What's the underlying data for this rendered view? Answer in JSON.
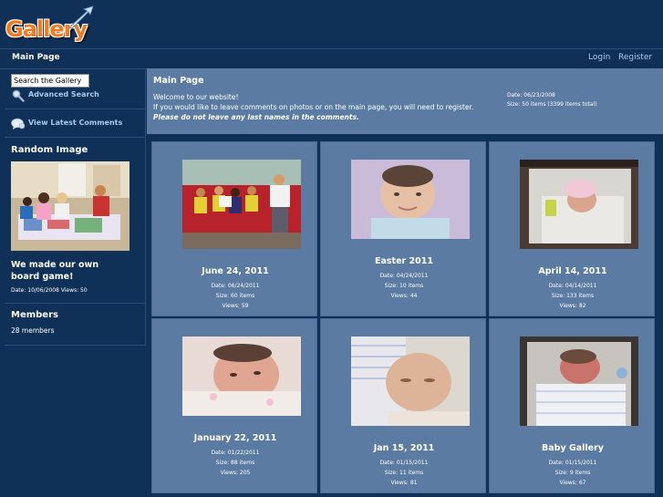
{
  "header": {
    "logo_text": "Gallery"
  },
  "nav": {
    "title": "Main Page",
    "login": "Login",
    "register": "Register"
  },
  "sidebar": {
    "search_value": "Search the Gallery",
    "advanced_search": "Advanced Search",
    "latest_comments": "View Latest Comments",
    "random_heading": "Random Image",
    "random_title": "We made our own board game!",
    "random_meta": "Date: 10/06/2008 Views: 50",
    "members_heading": "Members",
    "members_count": "28 members"
  },
  "main": {
    "title": "Main Page",
    "welcome": "Welcome to our website!",
    "comment_info": "If you would like to leave comments on photos or on the main page, you will need to register.",
    "warning": "Please do not leave any last names in the comments.",
    "date": "Date: 06/23/2008",
    "size": "Size: 50 items (3399 items total)"
  },
  "albums": [
    {
      "title": "June 24, 2011",
      "date": "Date: 06/24/2011",
      "size": "Size: 60 items",
      "views": "Views: 59"
    },
    {
      "title": "Easter 2011",
      "date": "Date: 04/24/2011",
      "size": "Size: 10 items",
      "views": "Views: 44"
    },
    {
      "title": "April 14, 2011",
      "date": "Date: 04/14/2011",
      "size": "Size: 133 items",
      "views": "Views: 82"
    },
    {
      "title": "January 22, 2011",
      "date": "Date: 01/22/2011",
      "size": "Size: 88 items",
      "views": "Views: 205"
    },
    {
      "title": "Jan 15, 2011",
      "date": "Date: 01/15/2011",
      "size": "Size: 11 items",
      "views": "Views: 81"
    },
    {
      "title": "Baby Gallery",
      "date": "Date: 01/15/2011",
      "size": "Size: 9 items",
      "views": "Views: 67"
    }
  ]
}
